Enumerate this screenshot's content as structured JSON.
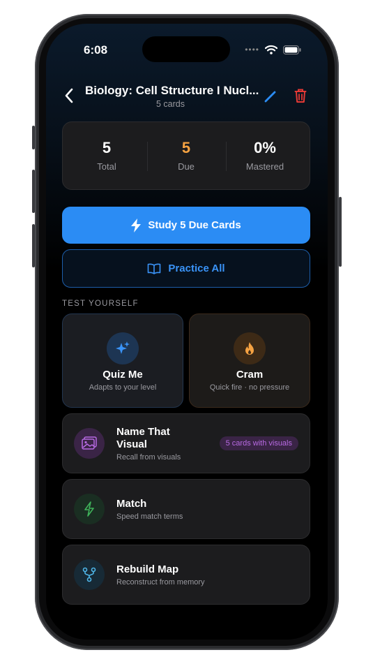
{
  "status": {
    "time": "6:08"
  },
  "header": {
    "title": "Biology: Cell Structure I Nucl...",
    "subtitle": "5 cards"
  },
  "stats": [
    {
      "value": "5",
      "label": "Total",
      "color": "#ffffff"
    },
    {
      "value": "5",
      "label": "Due",
      "color": "#f5a242"
    },
    {
      "value": "0%",
      "label": "Mastered",
      "color": "#ffffff"
    }
  ],
  "actions": {
    "study_label": "Study 5 Due Cards",
    "practice_label": "Practice All"
  },
  "section_label": "TEST YOURSELF",
  "modes": {
    "quiz": {
      "title": "Quiz Me",
      "subtitle": "Adapts to your level",
      "icon": "sparkles-icon"
    },
    "cram": {
      "title": "Cram",
      "subtitle": "Quick fire · no pressure",
      "icon": "flame-icon"
    },
    "name_that_visual": {
      "title_line1": "Name That",
      "title_line2": "Visual",
      "subtitle": "Recall from visuals",
      "badge": "5 cards with visuals",
      "icon": "image-icon"
    },
    "match": {
      "title": "Match",
      "subtitle": "Speed match terms",
      "icon": "bolt-icon"
    },
    "rebuild_map": {
      "title": "Rebuild Map",
      "subtitle": "Reconstruct from memory",
      "icon": "branch-icon"
    }
  },
  "colors": {
    "accent": "#2b8cf4",
    "due": "#f5a242",
    "danger": "#e53935",
    "visual": "#b86ae3",
    "match": "#3fb35a",
    "map": "#4fb6e8"
  }
}
